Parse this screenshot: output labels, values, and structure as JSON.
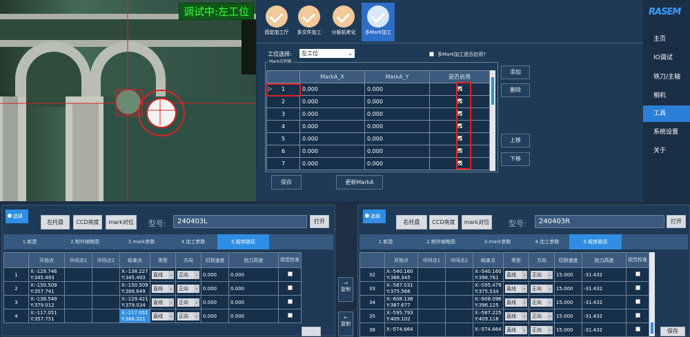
{
  "camera": {
    "status": "调试中:左工位"
  },
  "toolbar": {
    "tabs": [
      {
        "label": "固定加工厅"
      },
      {
        "label": "多文件加工"
      },
      {
        "label": "分板机老化"
      },
      {
        "label": "多Mark加工"
      }
    ]
  },
  "brand": {
    "logo": "RASEM"
  },
  "nav": {
    "items": [
      {
        "label": "主页"
      },
      {
        "label": "IO调试"
      },
      {
        "label": "铣刀/主轴"
      },
      {
        "label": "相机"
      },
      {
        "label": "工具"
      },
      {
        "label": "系统设置"
      },
      {
        "label": "关于"
      }
    ]
  },
  "station": {
    "label": "工位选择:",
    "value": "左工位",
    "mark_enable_label": "多Mark加工是否启用?"
  },
  "mark_list": {
    "legend": "Mark点列表",
    "headers": [
      "MarkA_X",
      "MarkA_Y",
      "是否启用"
    ],
    "rows": [
      {
        "no": "1",
        "x": "0.000",
        "y": "0.000"
      },
      {
        "no": "2",
        "x": "0.000",
        "y": "0.000"
      },
      {
        "no": "3",
        "x": "0.000",
        "y": "0.000"
      },
      {
        "no": "4",
        "x": "0.000",
        "y": "0.000"
      },
      {
        "no": "5",
        "x": "0.000",
        "y": "0.000"
      },
      {
        "no": "6",
        "x": "0.000",
        "y": "0.000"
      },
      {
        "no": "7",
        "x": "0.000",
        "y": "0.000"
      }
    ],
    "add": "添加",
    "delete": "删除",
    "up": "上移",
    "down": "下移",
    "save": "保存",
    "update": "更新MarkA"
  },
  "left_panel": {
    "select": "选择",
    "tray": "左托盘",
    "ccd": "CCD亮度",
    "mark": "mark对位",
    "model_label": "型号:",
    "model": "240403L",
    "open": "打开",
    "tabs": [
      "1.新建",
      "2.制作缩略图",
      "3.mark参数",
      "4.加工参数",
      "5.程序路径"
    ],
    "headers": [
      "开始点",
      "中间点1",
      "中间点2",
      "结束点",
      "类型",
      "方向",
      "切割速度",
      "抬刀高度",
      "视觉校准"
    ],
    "rows": [
      {
        "no": "1",
        "start1": "X:-129.746",
        "start2": "Y:345.493",
        "end1": "X:-138.227",
        "end2": "Y:345.493",
        "type": "直线",
        "dir": "正向",
        "speed": "0.000",
        "height": "0.000"
      },
      {
        "no": "2",
        "start1": "X:-150.509",
        "start2": "Y:357.741",
        "end1": "X:-150.509",
        "end2": "Y:366.649",
        "type": "直线",
        "dir": "正向",
        "speed": "0.000",
        "height": "0.000"
      },
      {
        "no": "3",
        "start1": "X:-138.549",
        "start2": "Y:379.012",
        "end1": "X:-129.421",
        "end2": "Y:379.034",
        "type": "直线",
        "dir": "正向",
        "speed": "0.000",
        "height": "0.000"
      },
      {
        "no": "4",
        "start1": "X:-117.051",
        "start2": "Y:357.751",
        "end1": "X:-117.051",
        "end2": "Y:366.321",
        "type": "直线",
        "dir": "正向",
        "speed": "0.000",
        "height": "0.000"
      }
    ]
  },
  "copy": {
    "label1": "复制",
    "label2": "复制"
  },
  "right_panel": {
    "select": "选择",
    "tray": "右托盘",
    "ccd": "CCD亮度",
    "mark": "mark对位",
    "model_label": "型号:",
    "model": "240403R",
    "open": "打开",
    "tabs": [
      "1.新建",
      "2.制作缩略图",
      "3.mark参数",
      "4.加工参数",
      "5.程序路径"
    ],
    "headers": [
      "开始点",
      "中间点1",
      "中间点2",
      "结束点",
      "类型",
      "方向",
      "切割速度",
      "抬刀高度",
      "视觉校准"
    ],
    "rows": [
      {
        "no": "32",
        "start1": "X:-540.160",
        "start2": "Y:388.345",
        "end1": "X:-540.160",
        "end2": "Y:396.761",
        "type": "直线",
        "dir": "正向",
        "speed": "15.000",
        "height": "-31.432"
      },
      {
        "no": "33",
        "start1": "X:-587.031",
        "start2": "Y:375.566",
        "end1": "X:-595.479",
        "end2": "Y:375.534",
        "type": "直线",
        "dir": "正向",
        "speed": "15.000",
        "height": "-31.432"
      },
      {
        "no": "34",
        "start1": "X:-608.136",
        "start2": "Y:387.677",
        "end1": "X:-608.096",
        "end2": "Y:396.125",
        "type": "直线",
        "dir": "正向",
        "speed": "15.000",
        "height": "-31.432"
      },
      {
        "no": "35",
        "start1": "X:-595.793",
        "start2": "Y:409.102",
        "end1": "X:-587.225",
        "end2": "Y:409.118",
        "type": "直线",
        "dir": "正向",
        "speed": "15.000",
        "height": "-31.432"
      },
      {
        "no": "36",
        "start1": "X:-574.664",
        "start2": "",
        "end1": "X:-574.664",
        "end2": "",
        "type": "直线",
        "dir": "正向",
        "speed": "15.000",
        "height": "-31.432"
      }
    ],
    "save": "保存"
  }
}
